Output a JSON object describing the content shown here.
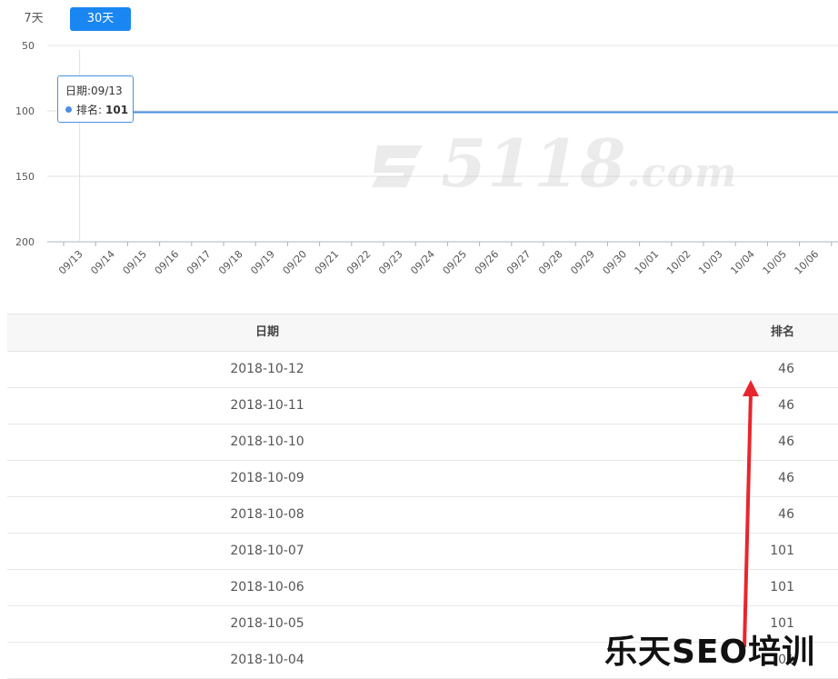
{
  "range_tabs": {
    "seven_day": "7天",
    "thirty_day": "30天"
  },
  "tooltip": {
    "date_line": "日期:09/13",
    "rank_label": "排名:",
    "rank_value": "101"
  },
  "watermark": {
    "text": "5118",
    "suffix": ".com"
  },
  "chart_data": {
    "type": "line",
    "x": [
      "09/13",
      "09/14",
      "09/15",
      "09/16",
      "09/17",
      "09/18",
      "09/19",
      "09/20",
      "09/21",
      "09/22",
      "09/23",
      "09/24",
      "09/25",
      "09/26",
      "09/27",
      "09/28",
      "09/29",
      "09/30",
      "10/01",
      "10/02",
      "10/03",
      "10/04",
      "10/05",
      "10/06"
    ],
    "series": [
      {
        "values": [
          101,
          101,
          101,
          101,
          101,
          101,
          101,
          101,
          101,
          101,
          101,
          101,
          101,
          101,
          101,
          101,
          101,
          101,
          101,
          101,
          101,
          101,
          101,
          101
        ]
      }
    ],
    "yticks": [
      50,
      100,
      150,
      200
    ],
    "ylim": [
      200,
      50
    ],
    "y_inverted": true,
    "grid": true,
    "line_color": "#4a90e2"
  },
  "table": {
    "headers": {
      "date": "日期",
      "rank": "排名"
    },
    "rows": [
      {
        "date": "2018-10-12",
        "rank": "46"
      },
      {
        "date": "2018-10-11",
        "rank": "46"
      },
      {
        "date": "2018-10-10",
        "rank": "46"
      },
      {
        "date": "2018-10-09",
        "rank": "46"
      },
      {
        "date": "2018-10-08",
        "rank": "46"
      },
      {
        "date": "2018-10-07",
        "rank": "101"
      },
      {
        "date": "2018-10-06",
        "rank": "101"
      },
      {
        "date": "2018-10-05",
        "rank": "101"
      },
      {
        "date": "2018-10-04",
        "rank": "101"
      }
    ]
  },
  "annotation": {
    "arrow_color": "#e8262d",
    "brand_text": "乐天SEO培训"
  }
}
